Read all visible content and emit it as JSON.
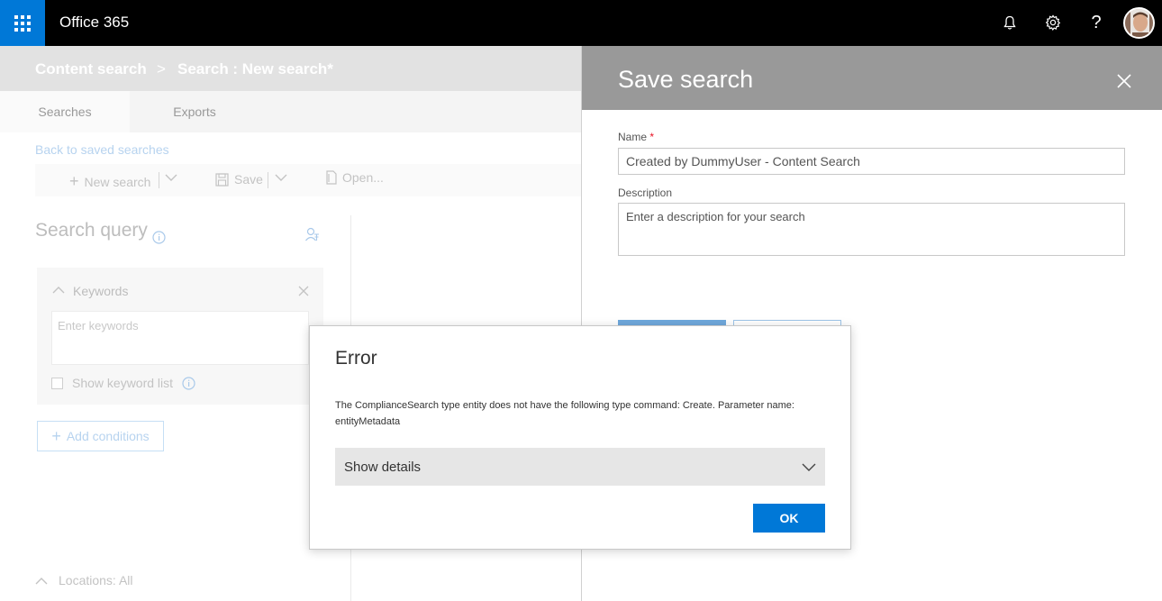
{
  "app": {
    "title": "Office 365"
  },
  "topbar_icons": [
    "bell-icon",
    "gear-icon",
    "help-icon",
    "avatar"
  ],
  "breadcrumb": {
    "root": "Content search",
    "separator": ">",
    "current": "Search : New search*"
  },
  "tabs": [
    {
      "label": "Searches",
      "active": true
    },
    {
      "label": "Exports",
      "active": false
    }
  ],
  "back_link": "Back to saved searches",
  "toolbar": {
    "new_search": "New search",
    "save": "Save",
    "open": "Open..."
  },
  "search_query": {
    "title": "Search query",
    "keywords_label": "Keywords",
    "keywords_placeholder": "Enter keywords",
    "show_keyword_list": "Show keyword list",
    "add_conditions": "Add conditions",
    "locations": "Locations: All"
  },
  "save_panel": {
    "title": "Save search",
    "name_label": "Name",
    "name_required": "*",
    "name_value": "Created by DummyUser - Content Search",
    "description_label": "Description",
    "description_placeholder": "Enter a description for your search"
  },
  "error_dialog": {
    "title": "Error",
    "message": "The ComplianceSearch type entity does not have the following type command: Create. Parameter name: entityMetadata",
    "show_details": "Show details",
    "ok": "OK"
  },
  "colors": {
    "brand_blue": "#0078d7",
    "topbar": "#000000",
    "panel_header": "#999999"
  }
}
